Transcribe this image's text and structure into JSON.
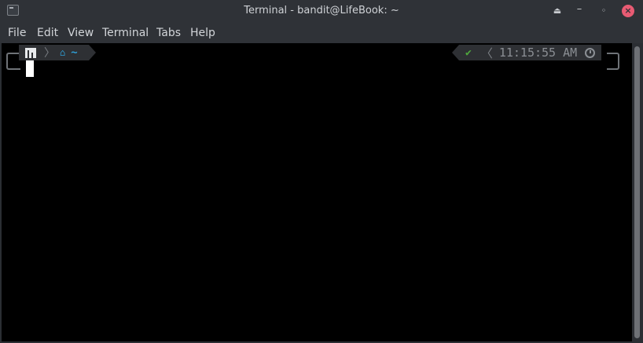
{
  "window": {
    "title": "Terminal - bandit@LifeBook: ~",
    "buttons": {
      "keep_above": "⏏",
      "minimize": "–",
      "maximize": "◦",
      "close": "×"
    }
  },
  "menubar": {
    "items": [
      "File",
      "Edit",
      "View",
      "Terminal",
      "Tabs",
      "Help"
    ]
  },
  "prompt": {
    "os_icon": "distro-logo-icon",
    "home_icon": "home-icon",
    "home_glyph": "⌂",
    "cwd": "~",
    "separator": "〉",
    "status_glyph": "✔",
    "right_separator": "〈",
    "time": "11:15:55 AM",
    "clock_icon": "clock-icon"
  },
  "colors": {
    "terminal_bg": "#000000",
    "prompt_segment_bg": "#2e3034",
    "cwd_blue": "#2f9fd6",
    "status_green": "#4fa83d",
    "close_red": "#e85b73"
  }
}
